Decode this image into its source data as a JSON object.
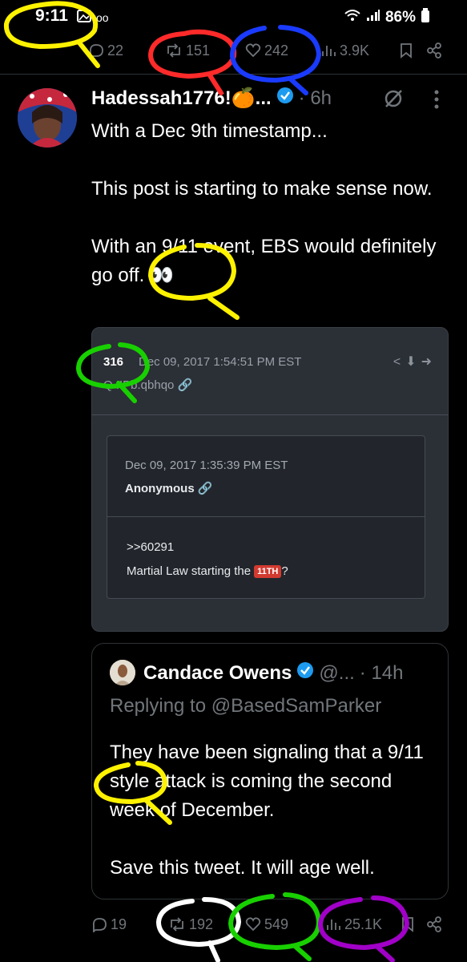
{
  "status_bar": {
    "time": "9:11",
    "battery": "86%"
  },
  "top_actions": {
    "replies": "22",
    "reposts": "151",
    "likes": "242",
    "views": "3.9K"
  },
  "tweet": {
    "author_name": "Hadessah1776!🍊...",
    "time": "· 6h",
    "body": [
      "With a Dec 9th timestamp...",
      "This post is starting to make sense now.",
      "With an 9/11 event, EBS would definitely go off. 👀"
    ]
  },
  "image_card": {
    "post_number": "316",
    "date": "Dec 09, 2017 1:54:51 PM EST",
    "sub_id": "Q !!Pb.qbhqo",
    "inner": {
      "date": "Dec 09, 2017 1:35:39 PM EST",
      "author": "Anonymous",
      "reference": ">>60291",
      "text_before": "Martial Law starting the",
      "tag": "11TH",
      "text_after": "?"
    }
  },
  "quote": {
    "author_name": "Candace Owens",
    "handle": "@...",
    "time": "· 14h",
    "replying_to": "Replying to @BasedSamParker",
    "body": [
      "They have been signaling that a 9/11 style attack is coming the second week of December.",
      "Save this tweet. It will age well."
    ]
  },
  "bottom_actions": {
    "replies": "19",
    "reposts": "192",
    "likes": "549",
    "views": "25.1K"
  },
  "colors": {
    "background": "#000000",
    "text": "#e7e9ea",
    "muted": "#71767b",
    "verified": "#1d9bf0",
    "scribble_yellow": "#fff200",
    "scribble_red": "#ff2a2a",
    "scribble_blue": "#1a3bff",
    "scribble_green": "#18d000",
    "scribble_white": "#ffffff",
    "scribble_purple": "#a100c8"
  }
}
